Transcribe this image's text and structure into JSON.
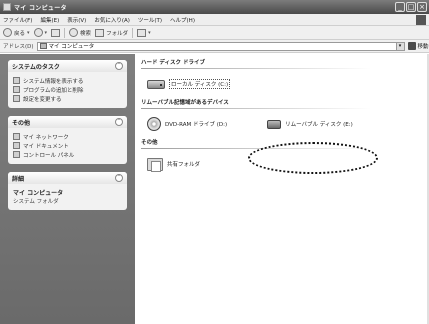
{
  "window": {
    "title": "マイ コンピュータ",
    "controls": [
      "_",
      "□",
      "×"
    ]
  },
  "menubar": {
    "items": [
      "ファイル(F)",
      "編集(E)",
      "表示(V)",
      "お気に入り(A)",
      "ツール(T)",
      "ヘルプ(H)"
    ]
  },
  "toolbar": {
    "back_label": "戻る",
    "search_label": "検索",
    "folders_label": "フォルダ"
  },
  "address": {
    "label": "アドレス(D)",
    "value": "マイ コンピュータ",
    "go_label": "移動"
  },
  "taskpane": {
    "system_tasks": {
      "title": "システムのタスク",
      "items": [
        "システム情報を表示する",
        "プログラムの追加と削除",
        "設定を変更する"
      ]
    },
    "other_places": {
      "title": "その他",
      "items": [
        "マイ ネットワーク",
        "マイ ドキュメント",
        "コントロール パネル"
      ]
    },
    "details": {
      "title": "詳細",
      "name": "マイ コンピュータ",
      "subtitle": "システム フォルダ"
    }
  },
  "content": {
    "hard_drives_header": "ハード ディスク ドライブ",
    "local_disk_label": "ローカル ディスク (C:)",
    "removable_header": "リムーバブル記憶域があるデバイス",
    "dvd_label": "DVD-RAM ドライブ (D:)",
    "removable_disk_label": "リムーバブル ディスク (E:)",
    "other_header": "その他",
    "shared_folder_label": "共有フォルダ"
  }
}
